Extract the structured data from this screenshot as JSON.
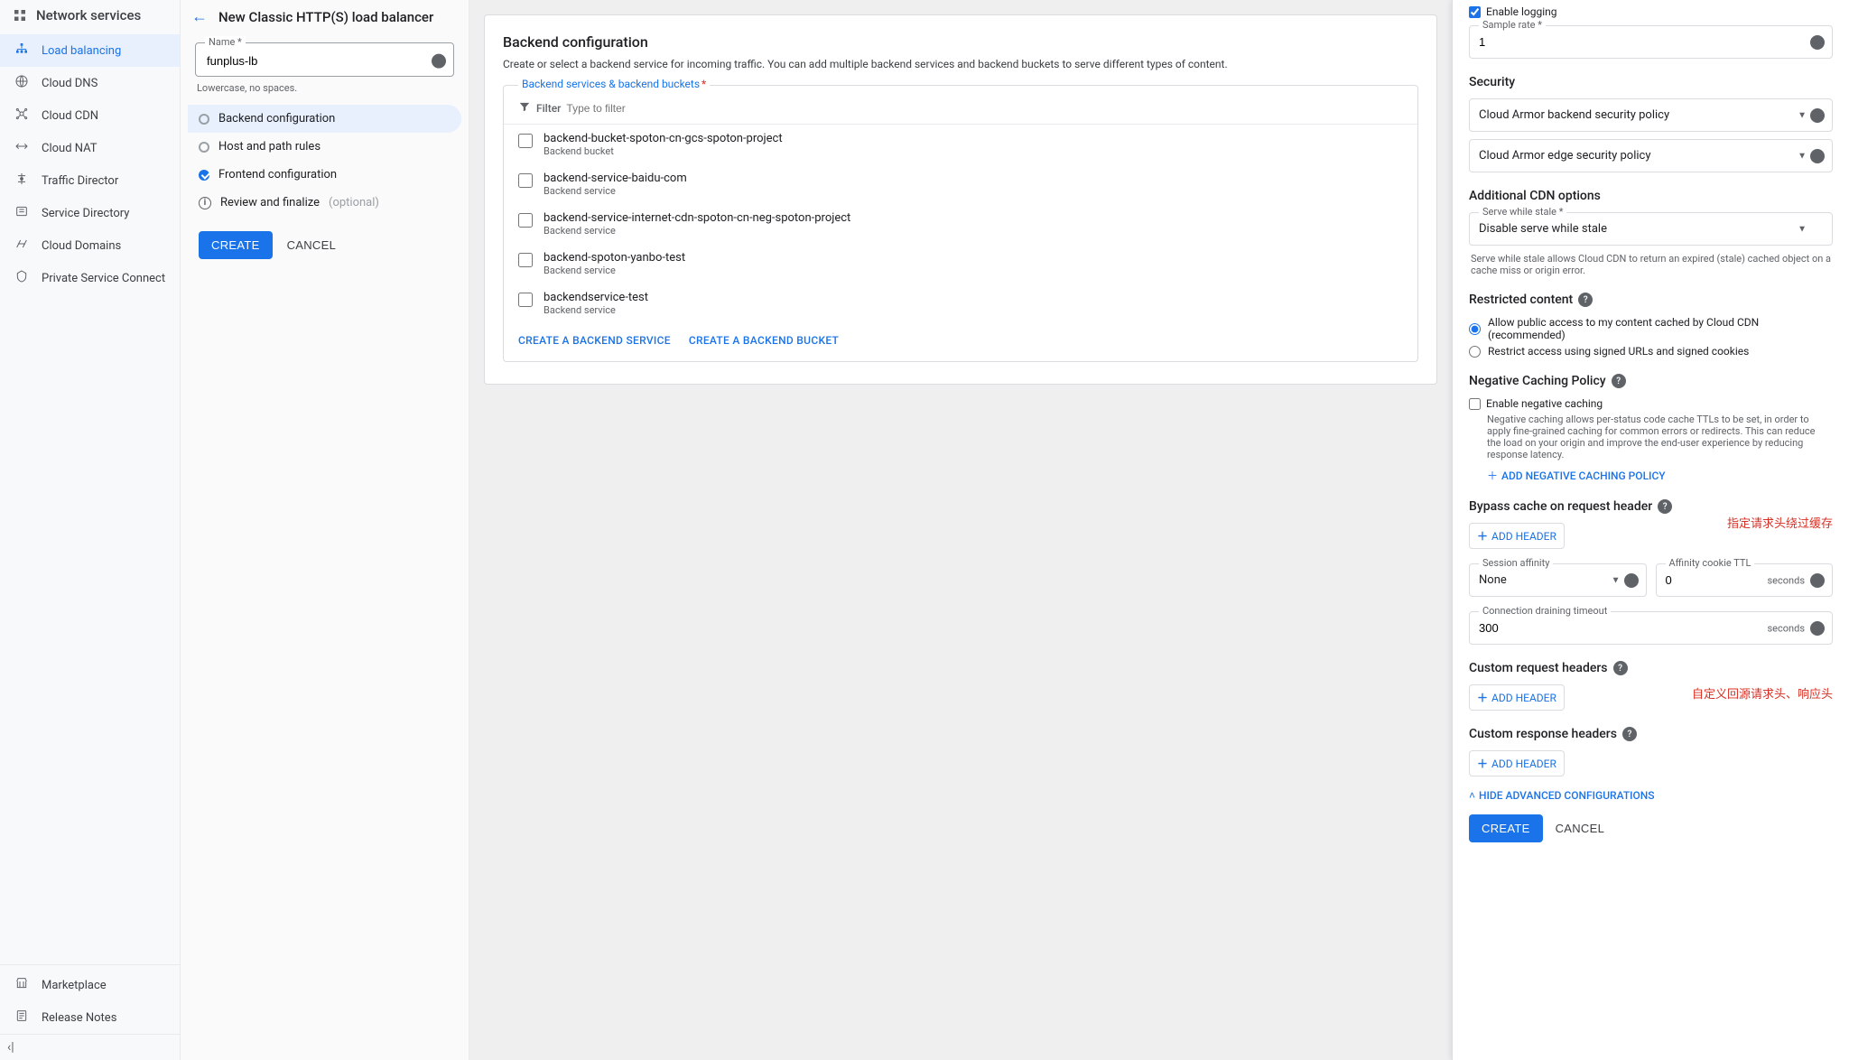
{
  "left_nav": {
    "title": "Network services",
    "items": [
      {
        "label": "Load balancing",
        "active": true
      },
      {
        "label": "Cloud DNS"
      },
      {
        "label": "Cloud CDN"
      },
      {
        "label": "Cloud NAT"
      },
      {
        "label": "Traffic Director"
      },
      {
        "label": "Service Directory"
      },
      {
        "label": "Cloud Domains"
      },
      {
        "label": "Private Service Connect"
      }
    ],
    "bottom": [
      {
        "label": "Marketplace"
      },
      {
        "label": "Release Notes"
      }
    ]
  },
  "wizard": {
    "title": "New Classic HTTP(S) load balancer",
    "name_label": "Name *",
    "name_value": "funplus-lb",
    "name_hint": "Lowercase, no spaces.",
    "steps": {
      "backend": "Backend configuration",
      "host": "Host and path rules",
      "frontend": "Frontend configuration",
      "review": "Review and finalize",
      "review_opt": "(optional)"
    },
    "create": "CREATE",
    "cancel": "CANCEL"
  },
  "backend": {
    "title": "Backend configuration",
    "desc": "Create or select a backend service for incoming traffic. You can add multiple backend services and backend buckets to serve different types of content.",
    "legend": "Backend services & backend buckets",
    "filter_prefix": "Filter",
    "filter_placeholder": "Type to filter",
    "items": [
      {
        "name": "backend-bucket-spoton-cn-gcs-spoton-project",
        "type": "Backend bucket"
      },
      {
        "name": "backend-service-baidu-com",
        "type": "Backend service"
      },
      {
        "name": "backend-service-internet-cdn-spoton-cn-neg-spoton-project",
        "type": "Backend service"
      },
      {
        "name": "backend-spoton-yanbo-test",
        "type": "Backend service"
      },
      {
        "name": "backendservice-test",
        "type": "Backend service"
      }
    ],
    "create_service": "CREATE A BACKEND SERVICE",
    "create_bucket": "CREATE A BACKEND BUCKET"
  },
  "drawer": {
    "enable_logging": "Enable logging",
    "sample_rate_label": "Sample rate *",
    "sample_rate_value": "1",
    "security_title": "Security",
    "armor_backend": "Cloud Armor backend security policy",
    "armor_edge": "Cloud Armor edge security policy",
    "cdn_title": "Additional CDN options",
    "serve_stale_label": "Serve while stale *",
    "serve_stale_value": "Disable serve while stale",
    "serve_stale_hint": "Serve while stale allows Cloud CDN to return an expired (stale) cached object on a cache miss or origin error.",
    "restricted_title": "Restricted content",
    "restricted_allow": "Allow public access to my content cached by Cloud CDN (recommended)",
    "restricted_restrict": "Restrict access using signed URLs and signed cookies",
    "neg_title": "Negative Caching Policy",
    "neg_enable": "Enable negative caching",
    "neg_hint": "Negative caching allows per-status code cache TTLs to be set, in order to apply fine-grained caching for common errors or redirects. This can reduce the load on your origin and improve the end-user experience by reducing response latency.",
    "neg_add": "ADD NEGATIVE CACHING POLICY",
    "bypass_title": "Bypass cache on request header",
    "bypass_annot": "指定请求头绕过缓存",
    "add_header": "ADD HEADER",
    "affinity_label": "Session affinity",
    "affinity_value": "None",
    "cookie_label": "Affinity cookie TTL",
    "cookie_value": "0",
    "seconds": "seconds",
    "drain_label": "Connection draining timeout",
    "drain_value": "300",
    "req_headers_title": "Custom request headers",
    "resp_headers_title": "Custom response headers",
    "custom_annot": "自定义回源请求头、响应头",
    "hide_adv": "HIDE ADVANCED CONFIGURATIONS",
    "create": "CREATE",
    "cancel": "CANCEL"
  }
}
